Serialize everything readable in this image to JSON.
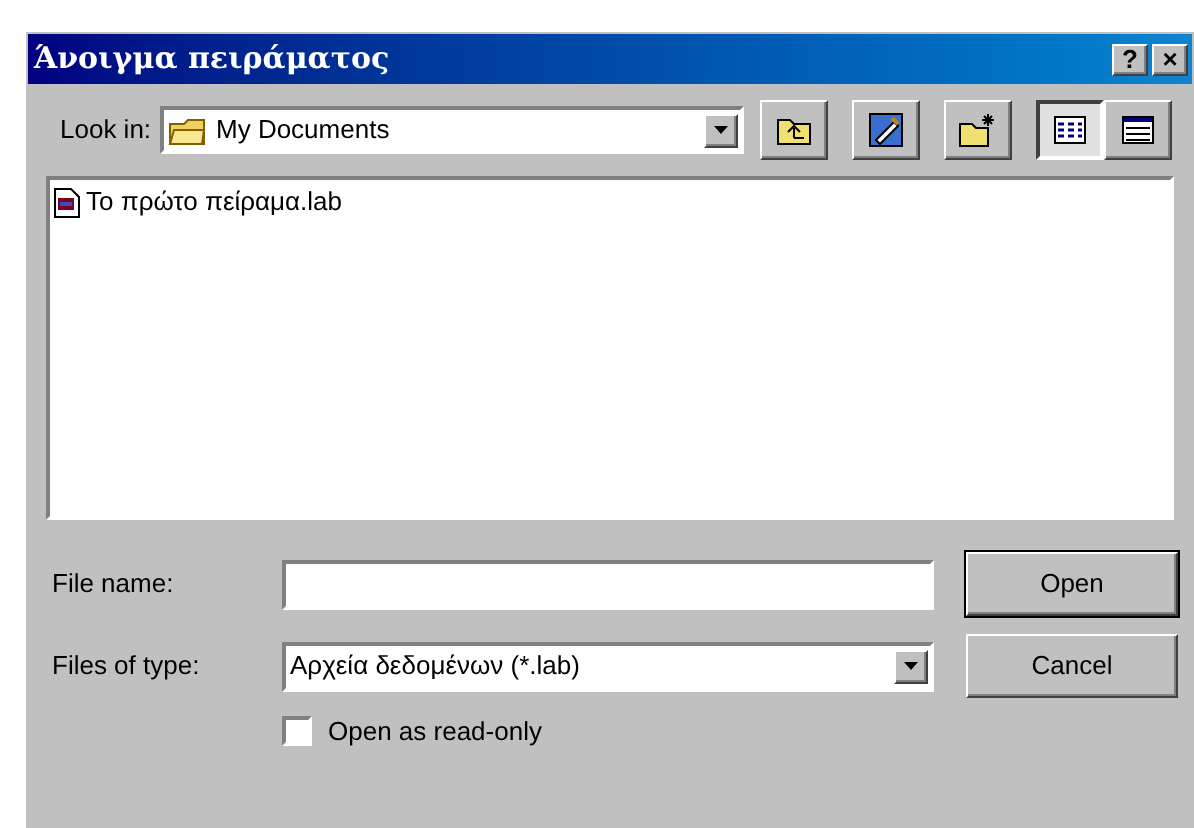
{
  "window": {
    "title": "Άνοιγμα πειράματος",
    "title_buttons": [
      "?",
      "×"
    ]
  },
  "look_in": {
    "label": "Look in:",
    "value": "My Documents"
  },
  "toolbar": [
    {
      "kind": "up",
      "selected": false
    },
    {
      "kind": "desktop",
      "selected": false
    },
    {
      "kind": "new_folder",
      "selected": false
    },
    {
      "kind": "list",
      "selected": true
    },
    {
      "kind": "details",
      "selected": false
    }
  ],
  "files": [
    {
      "name": "Το πρώτο πείραμα.lab"
    }
  ],
  "file_name": {
    "label": "File name:"
  },
  "file_type": {
    "label": "Files of type:",
    "value": "Αρχεία δεδομένων (*.lab)"
  },
  "read_only": {
    "label": "Open as read-only",
    "checked": false
  },
  "buttons": [
    {
      "label": "Open",
      "default": true
    },
    {
      "label": "Cancel",
      "default": false
    }
  ]
}
